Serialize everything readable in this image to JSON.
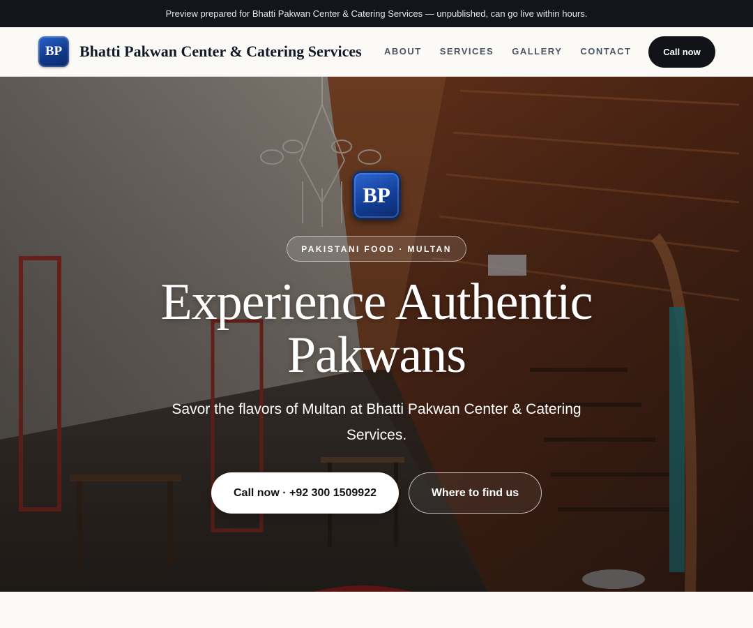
{
  "announcement": "Preview prepared for Bhatti Pakwan Center & Catering Services — unpublished, can go live within hours.",
  "brand": {
    "initials": "BP",
    "name": "Bhatti Pakwan Center & Catering Services",
    "accent_color": "#1b4aa8"
  },
  "nav": {
    "links": [
      "ABOUT",
      "SERVICES",
      "GALLERY",
      "CONTACT"
    ],
    "cta_label": "Call now"
  },
  "hero": {
    "logo_initials": "BP",
    "tagline": "PAKISTANI FOOD · MULTAN",
    "title": "Experience Authentic Pakwans",
    "subtitle": "Savor the flavors of Multan at Bhatti Pakwan Center & Catering Services.",
    "primary_cta": "Call now · +92 300 1509922",
    "secondary_cta": "Where to find us",
    "background_image": "restaurant-interior-photo"
  },
  "colors": {
    "topbar_bg": "#12161c",
    "nav_bg": "#fbfaf7",
    "dark_button": "#111318"
  }
}
